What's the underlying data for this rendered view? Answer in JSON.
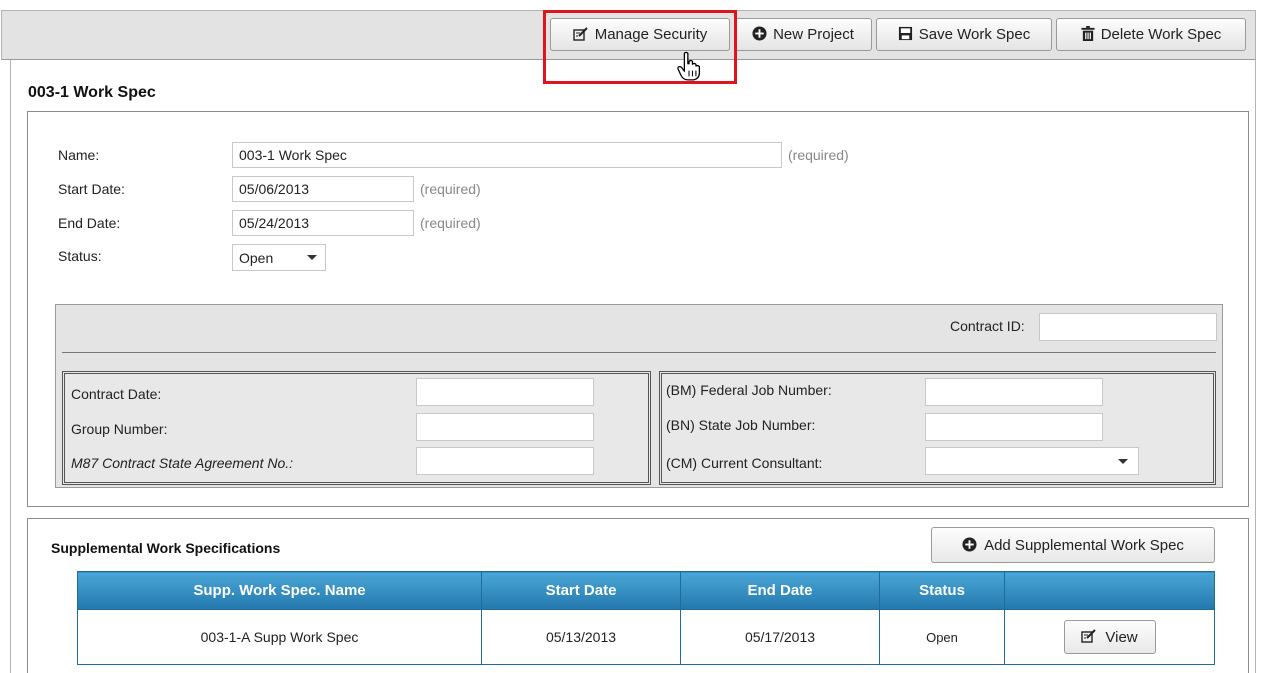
{
  "toolbar": {
    "manage_security": "Manage Security",
    "new_project": "New Project",
    "save_work_spec": "Save Work Spec",
    "delete_work_spec": "Delete Work Spec"
  },
  "page_title": "003-1 Work Spec",
  "form": {
    "name_label": "Name:",
    "name_value": "003-1 Work Spec",
    "start_label": "Start Date:",
    "start_value": "05/06/2013",
    "end_label": "End Date:",
    "end_value": "05/24/2013",
    "status_label": "Status:",
    "status_value": "Open",
    "required": "(required)"
  },
  "contract": {
    "contract_id_label": "Contract ID:",
    "contract_id_value": "",
    "contract_date_label": "Contract Date:",
    "group_number_label": "Group Number:",
    "m87_label": "M87 Contract State Agreement No.:",
    "federal_job_label": "(BM) Federal Job Number:",
    "state_job_label": "(BN) State Job Number:",
    "consultant_label": "(CM) Current Consultant:"
  },
  "supplemental": {
    "title": "Supplemental Work Specifications",
    "add_button": "Add Supplemental Work Spec",
    "columns": [
      "Supp. Work Spec. Name",
      "Start Date",
      "End Date",
      "Status",
      ""
    ],
    "rows": [
      {
        "name": "003-1-A Supp Work Spec",
        "start": "05/13/2013",
        "end": "05/17/2013",
        "status": "Open",
        "action": "View"
      }
    ]
  },
  "colors": {
    "highlight": "#e0141e",
    "grid_header": "#2f86bd"
  },
  "icons": [
    "edit-icon",
    "plus-circle-icon",
    "save-icon",
    "trash-icon",
    "hand-cursor-icon"
  ]
}
